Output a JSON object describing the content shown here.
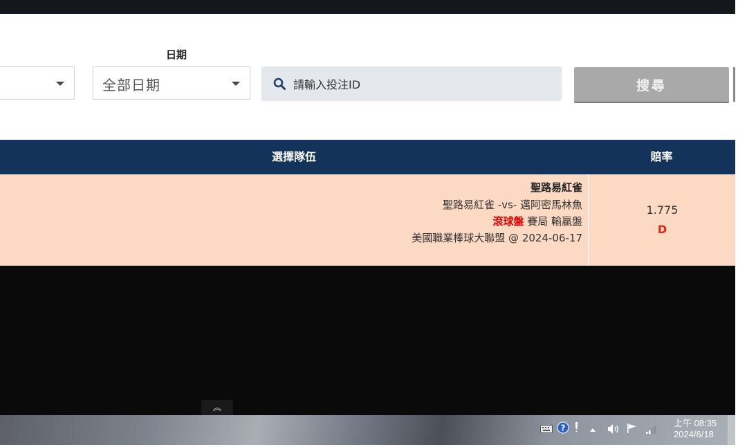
{
  "filters": {
    "date_label": "日期",
    "left_select_value": "",
    "date_select_value": "全部日期",
    "search_placeholder": "請輸入投注ID",
    "search_button": "搜尋"
  },
  "table": {
    "headers": {
      "team": "選擇隊伍",
      "odds": "賠率"
    },
    "rows": [
      {
        "selected_team": "聖路易紅雀",
        "matchup": "聖路易紅雀 -vs- 邁阿密馬林魚",
        "market_type": "滾球盤",
        "market_detail": "賽局 輸贏盤",
        "league_date": "美國職業棒球大聯盟 @ 2024-06-17",
        "odds": "1.775",
        "status": "D"
      }
    ]
  },
  "scroll_top_glyph": "︽",
  "taskbar": {
    "time": "上午 08:35",
    "date": "2024/6/18",
    "tray_icons": [
      "keyboard-icon",
      "help-icon",
      "pen-icon",
      "show-hidden-icon",
      "volume-icon",
      "flag-icon",
      "signal-icon"
    ]
  },
  "colors": {
    "header_bg": "#13335a",
    "row_bg": "#fbd9c3",
    "accent_red": "#e00000",
    "search_button_bg": "#a9a9a9"
  }
}
